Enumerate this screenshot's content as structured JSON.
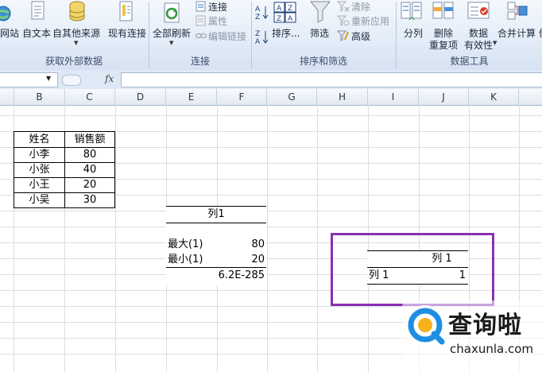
{
  "ribbon": {
    "get_external": {
      "web": "网站",
      "text": "自文本",
      "other": "自其他来源",
      "existing": "现有连接",
      "group_label": "获取外部数据"
    },
    "connections": {
      "refresh_all": "全部刷新",
      "connections": "连接",
      "properties": "属性",
      "edit_links": "编辑链接",
      "group_label": "连接"
    },
    "sort_filter": {
      "sort": "排序...",
      "filter": "筛选",
      "clear": "清除",
      "reapply": "重新应用",
      "advanced": "高级",
      "group_label": "排序和筛选"
    },
    "data_tools": {
      "split": "分列",
      "remove_dup_1": "删除",
      "remove_dup_2": "重复项",
      "validation_1": "数据",
      "validation_2": "有效性",
      "consolidate": "合并计算",
      "truncated": "假",
      "group_label": "数据工具"
    }
  },
  "formula_bar": {
    "fx": "fx",
    "name_box_value": "",
    "formula_value": ""
  },
  "columns": [
    "B",
    "C",
    "D",
    "E",
    "F",
    "G",
    "H",
    "I",
    "J",
    "K"
  ],
  "sales_table": {
    "headers": [
      "姓名",
      "销售额"
    ],
    "rows": [
      [
        "小李",
        "80"
      ],
      [
        "小张",
        "40"
      ],
      [
        "小王",
        "20"
      ],
      [
        "小吴",
        "30"
      ]
    ]
  },
  "stats": {
    "header": "列1",
    "max_label": "最大(1)",
    "max_value": "80",
    "min_label": "最小(1)",
    "min_value": "20",
    "p_value": "6.2E-285"
  },
  "correlation": {
    "col_header": "列 1",
    "row_header": "列 1",
    "value": "1"
  },
  "highlight_color": "#8b2fb3",
  "watermark": {
    "brand": "查询啦",
    "domain": "chaxunla.com"
  }
}
